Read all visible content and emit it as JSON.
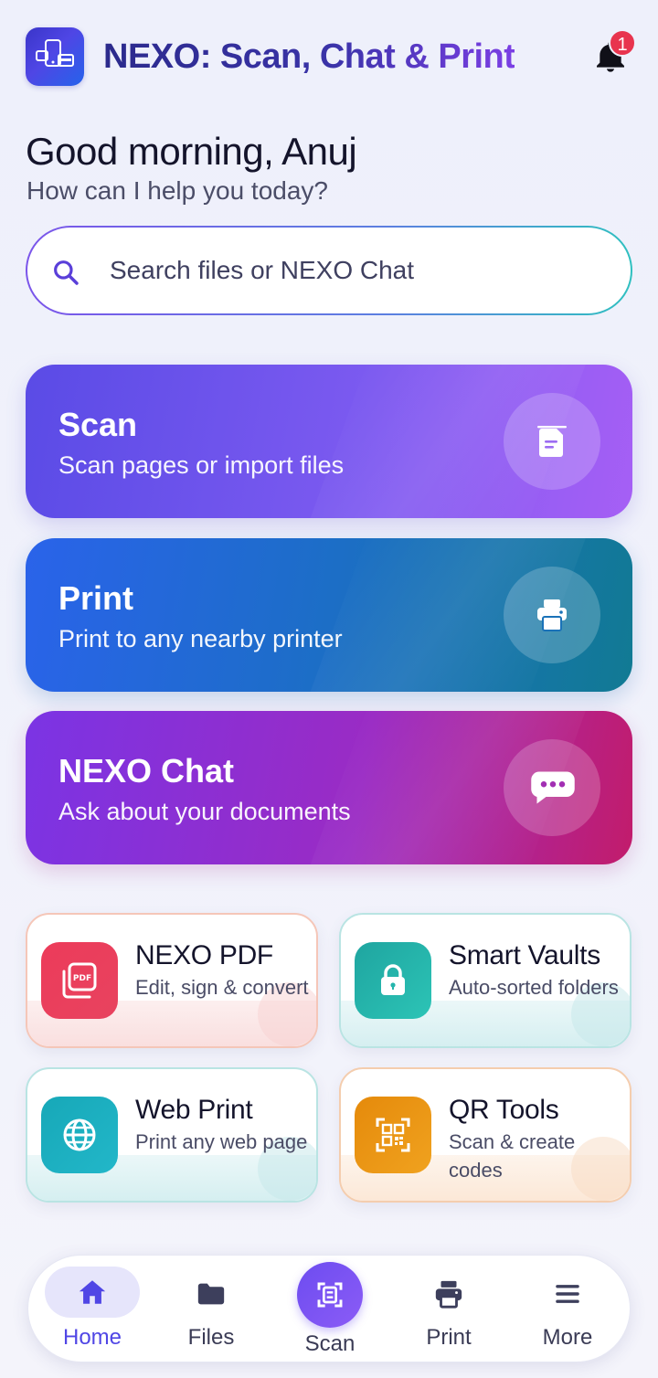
{
  "header": {
    "app_title": "NEXO: Scan, Chat & Print",
    "notification_count": "1"
  },
  "greeting": {
    "title": "Good morning, Anuj",
    "subtitle": "How can I help you today?"
  },
  "search": {
    "placeholder": "Search files or NEXO Chat",
    "value": ""
  },
  "actions": [
    {
      "title": "Scan",
      "subtitle": "Scan pages or import files",
      "icon": "document-scan-icon"
    },
    {
      "title": "Print",
      "subtitle": "Print to any nearby printer",
      "icon": "printer-icon"
    },
    {
      "title": "NEXO Chat",
      "subtitle": "Ask about your documents",
      "icon": "chat-bubble-icon"
    }
  ],
  "tools": [
    {
      "title": "NEXO PDF",
      "subtitle": "Edit, sign & convert",
      "icon": "pdf-icon",
      "color": "#e8435f"
    },
    {
      "title": "Smart Vaults",
      "subtitle": "Auto-sorted folders",
      "icon": "lock-icon",
      "color": "#25b5ac"
    },
    {
      "title": "Web Print",
      "subtitle": "Print any web page",
      "icon": "globe-icon",
      "color": "#1cb0c1"
    },
    {
      "title": "QR Tools",
      "subtitle": "Scan & create codes",
      "icon": "qr-code-icon",
      "color": "#ec9716"
    }
  ],
  "nav": [
    {
      "label": "Home",
      "icon": "home-icon",
      "active": true
    },
    {
      "label": "Files",
      "icon": "folder-icon",
      "active": false
    },
    {
      "label": "Scan",
      "icon": "scan-icon",
      "active": false
    },
    {
      "label": "Print",
      "icon": "printer-icon",
      "active": false
    },
    {
      "label": "More",
      "icon": "menu-icon",
      "active": false
    }
  ],
  "colors": {
    "accent": "#5046e5",
    "badge": "#e8344e"
  }
}
